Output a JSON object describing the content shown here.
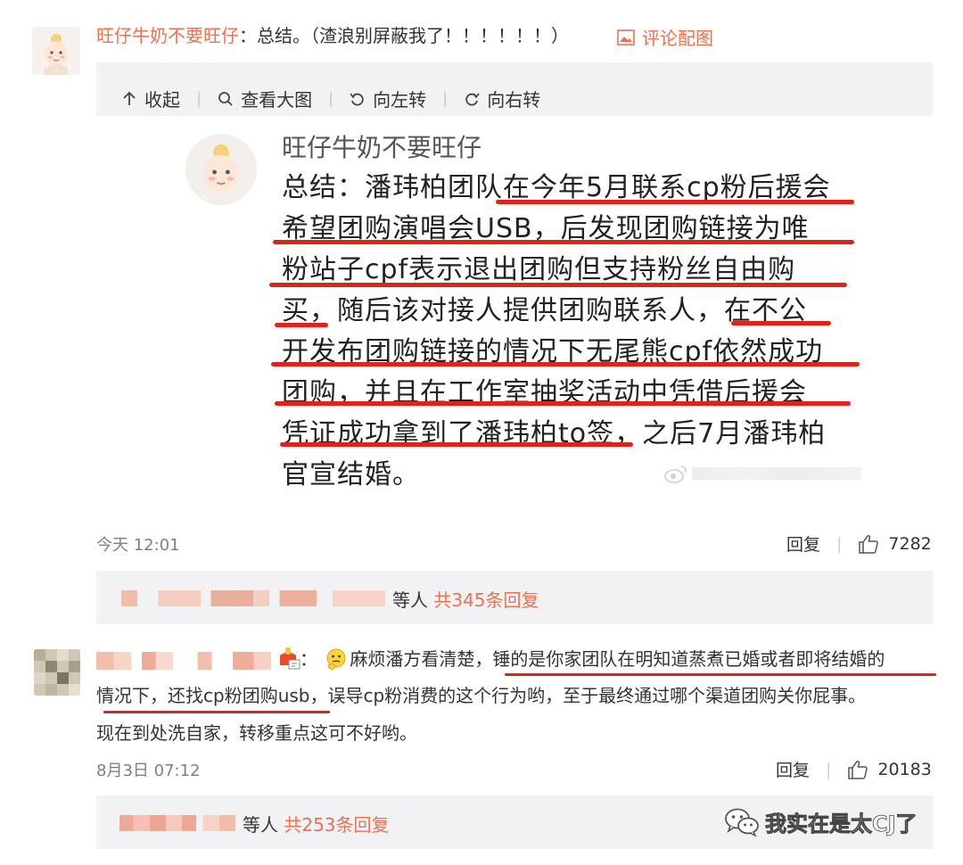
{
  "comment1": {
    "username": "旺仔牛奶不要旺仔",
    "separator": "：",
    "text": "总结。（渣浪别屏蔽我了！！！！！！）",
    "image_link": "评论配图",
    "toolbar": {
      "collapse": "收起",
      "view_large": "查看大图",
      "rotate_left": "向左转",
      "rotate_right": "向右转"
    },
    "image_content": {
      "username": "旺仔牛奶不要旺仔",
      "lines": [
        "总结：潘玮柏团队在今年5月联系cp粉后援会",
        "希望团购演唱会USB，后发现团购链接为唯",
        "粉站子cpf表示退出团购但支持粉丝自由购",
        "买，随后该对接人提供团购联系人，在不公",
        "开发布团购链接的情况下无尾熊cpf依然成功",
        "团购，并且在工作室抽奖活动中凭借后援会",
        "凭证成功拿到了潘玮柏to签，之后7月潘玮柏",
        "官宣结婚。"
      ]
    },
    "time": "今天 12:01",
    "reply_label": "回复",
    "likes": "7282",
    "replies_summary": {
      "etc": "等人",
      "count": "共345条回复"
    }
  },
  "comment2": {
    "colon": "：",
    "text_line1": "麻烦潘方看清楚，锤的是你家团队在明知道蒸煮已婚或者即将结婚的",
    "text_line2": "情况下，还找cp粉团购usb，误导cp粉消费的这个行为哟，至于最终通过哪个渠道团购关你屁事。",
    "text_line3": "现在到处洗自家，转移重点这可不好哟。",
    "time": "8月3日 07:12",
    "reply_label": "回复",
    "likes": "20183",
    "replies_summary": {
      "etc": "等人",
      "count": "共253条回复"
    }
  },
  "watermark": {
    "text": "我实在是太CJ了"
  },
  "colors": {
    "accent": "#eb7350",
    "highlight_red": "#e0231a",
    "panel_bg": "#f2f2f5"
  }
}
